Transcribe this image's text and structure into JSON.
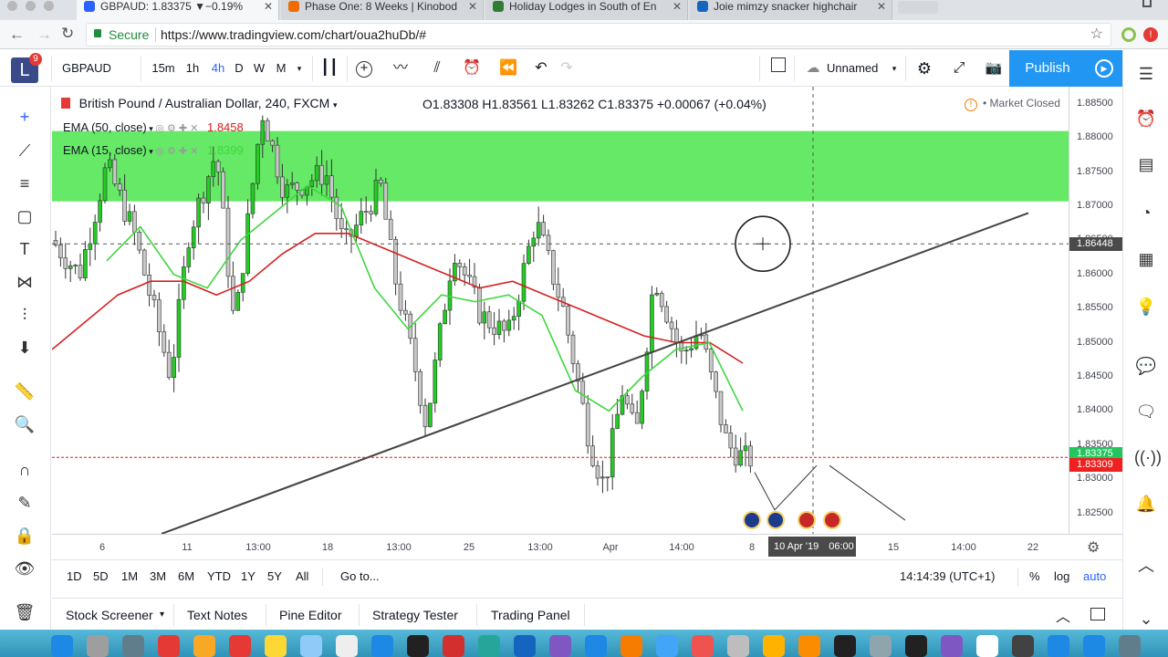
{
  "browser": {
    "tabs": [
      {
        "title": "GBPAUD: 1.83375 ▼−0.19%",
        "color": "#2962ff",
        "active": true
      },
      {
        "title": "Phase One: 8 Weeks | Kinobod",
        "color": "#ef6c00",
        "active": false
      },
      {
        "title": "Holiday Lodges in South of En",
        "color": "#2e7d32",
        "active": false
      },
      {
        "title": "Joie mimzy snacker highchair",
        "color": "#1565c0",
        "active": false
      }
    ],
    "secure_label": "Secure",
    "url": "https://www.tradingview.com/chart/oua2huDb/#"
  },
  "header": {
    "logo": "L",
    "notif_count": "9",
    "symbol": "GBPAUD",
    "intervals": [
      "15m",
      "1h",
      "4h",
      "D",
      "W",
      "M"
    ],
    "active_interval": "4h",
    "layout_name": "Unnamed",
    "publish_label": "Publish"
  },
  "legend": {
    "title": "British Pound / Australian Dollar, 240, FXCM",
    "ohlc": "O1.83308  H1.83561  L1.83262  C1.83375  +0.00067 (+0.04%)",
    "market_status": "Market Closed",
    "ema50_label": "EMA (50, close)",
    "ema50_value": "1.8458",
    "ema15_label": "EMA (15, close)",
    "ema15_value": "1.8399"
  },
  "price_axis": {
    "ticks": [
      "1.88500",
      "1.88000",
      "1.87500",
      "1.87000",
      "1.86500",
      "1.86000",
      "1.85500",
      "1.85000",
      "1.84500",
      "1.84000",
      "1.83500",
      "1.83000",
      "1.82500"
    ],
    "crosshair_price": "1.86448",
    "last_price": "1.83375",
    "last_price_color": "#22c55e",
    "red_line_price": "1.83309",
    "red_line_color": "#ef2020"
  },
  "time_axis": {
    "ticks": [
      "6",
      "11",
      "13:00",
      "18",
      "13:00",
      "25",
      "13:00",
      "Apr",
      "14:00",
      "8",
      "15",
      "14:00",
      "22"
    ],
    "crosshair_time": "10 Apr '19",
    "crosshair_hour": "06:00"
  },
  "range_bar": {
    "ranges": [
      "1D",
      "5D",
      "1M",
      "3M",
      "6M",
      "YTD",
      "1Y",
      "5Y",
      "All"
    ],
    "goto_label": "Go to...",
    "clock": "14:14:39 (UTC+1)",
    "percent_label": "%",
    "log_label": "log",
    "auto_label": "auto"
  },
  "panel_tabs": [
    "Stock Screener",
    "Text Notes",
    "Pine Editor",
    "Strategy Tester",
    "Trading Panel"
  ],
  "colors": {
    "zone": "#5ee85e",
    "bull": "#22cc22",
    "bear": "#c8c8c8",
    "ema15": "#3ed63e",
    "ema50": "#d62020",
    "accent": "#2962ff"
  },
  "chart_data": {
    "type": "candlestick",
    "title": "British Pound / Australian Dollar, 240, FXCM",
    "ylim": [
      1.822,
      1.8875
    ],
    "series": [
      {
        "name": "EMA (50, close)",
        "values": [
          1.849,
          1.853,
          1.857,
          1.859,
          1.859,
          1.857,
          1.859,
          1.863,
          1.866,
          1.866,
          1.864,
          1.862,
          1.86,
          1.858,
          1.859,
          1.857,
          1.855,
          1.853,
          1.851,
          1.85,
          1.85,
          1.847
        ]
      },
      {
        "name": "EMA (15, close)",
        "values": [
          1.862,
          1.867,
          1.86,
          1.858,
          1.865,
          1.869,
          1.873,
          1.87,
          1.858,
          1.852,
          1.857,
          1.856,
          1.857,
          1.854,
          1.843,
          1.84,
          1.845,
          1.849,
          1.85,
          1.84
        ]
      }
    ]
  }
}
